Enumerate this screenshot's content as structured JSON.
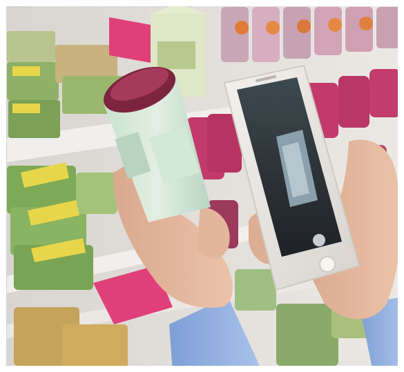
{
  "scene": {
    "description_key": "photo",
    "colors": {
      "shelf_back": "#e9e6e2",
      "shelf_edge": "#f4f2ef",
      "cup_pink": "#c23a6b",
      "cup_dark_lid": "#7d2540",
      "salad_green": "#6ea04a",
      "label_yellow": "#e8d64a",
      "sign_pink": "#e0407a",
      "skin": "#e2b79d",
      "sleeve_blue": "#8fb0e0",
      "phone_silver": "#e6e3df",
      "phone_screen_dark": "#2e3a40"
    }
  }
}
